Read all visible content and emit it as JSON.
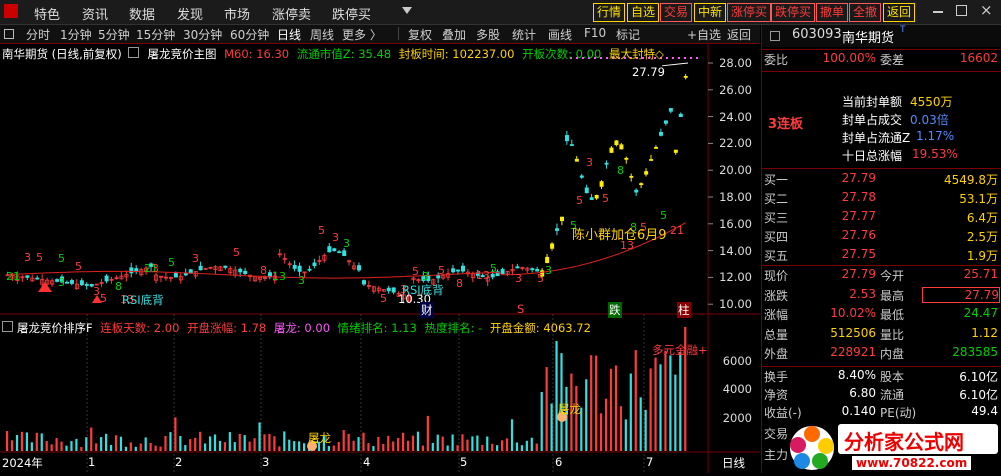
{
  "menu": {
    "items": [
      "特色",
      "资讯",
      "数据",
      "发现",
      "市场",
      "涨停卖",
      "跌停买"
    ],
    "top_buttons": [
      "行情",
      "自选",
      "交易",
      "中新",
      "涨停买",
      "跌停买",
      "撤单",
      "全撤",
      "返回"
    ]
  },
  "periods": {
    "items": [
      "分时",
      "1分钟",
      "5分钟",
      "15分钟",
      "30分钟",
      "60分钟",
      "日线",
      "周线",
      "更多 〉"
    ],
    "tools": [
      "复权",
      "叠加",
      "多股",
      "统计",
      "画线",
      "F10",
      "标记",
      "+自选",
      "返回"
    ]
  },
  "main_info": {
    "title": "南华期货 (日线,前复权)",
    "indicator": "屠龙竞价主图",
    "m60": "M60: 16.30",
    "float_mv": "流通市值Z: 35.48",
    "seal_time": "封板时间: 102237.00",
    "open_count": "开板次数: 0.00",
    "max_seal": "最大封特◇"
  },
  "price_axis": [
    "28.00",
    "26.00",
    "24.00",
    "22.00",
    "20.00",
    "18.00",
    "16.00",
    "14.00",
    "12.00",
    "10.00"
  ],
  "annotations": {
    "top_price": "27.79",
    "low_price": "10.30",
    "news": "陈小群加仓6月9",
    "rsi1": "RSI底背",
    "rsi2": "RSI底背",
    "zhu": "柱",
    "cai": "财",
    "s_mark": "S",
    "jiao": "跌",
    "duo": "多元金融+"
  },
  "seq_labels": [
    "21",
    "3",
    "5",
    "3",
    "5",
    "5",
    "3",
    "5",
    "8",
    "13",
    "21",
    "3",
    "5",
    "3",
    "5",
    "8",
    "13",
    "3",
    "5",
    "3",
    "3",
    "5",
    "3",
    "5",
    "3",
    "5",
    "8",
    "13",
    "5",
    "3",
    "5",
    "3",
    "5",
    "5",
    "3",
    "5",
    "8",
    "13",
    "8",
    "5",
    "5",
    "21",
    "3",
    "5",
    "3",
    "5",
    "3"
  ],
  "sub_info": {
    "indicator": "屠龙竞价排序F",
    "limit_days": "连板天数: 2.00",
    "open_rise": "开盘涨幅: 1.78",
    "tulong": "屠龙: 0.00",
    "mood_rank": "情绪排名: 1.13",
    "heat_rank": "热度排名: -",
    "open_amount": "开盘金额: 4063.72"
  },
  "sub_axis": [
    "6000",
    "4000",
    "2000"
  ],
  "sub_marks": [
    "屠龙",
    "屠龙"
  ],
  "timeline": [
    "2024年",
    "1",
    "2",
    "3",
    "4",
    "5",
    "6",
    "7"
  ],
  "timeline_right": "日线",
  "quote": {
    "code": "603093",
    "name": "南华期货",
    "wb_label": "委比",
    "wb": "100.00%",
    "wc_label": "委差",
    "wc": "16602",
    "seal_amount_label": "当前封单额",
    "seal_amount": "4550万",
    "seal_ratio_label": "封单占成交",
    "seal_ratio": "0.03倍",
    "seal_float_label": "封单占流通Z",
    "seal_float": "1.17%",
    "ten_day_label": "十日总涨幅",
    "ten_day": "19.53%",
    "streak": "3连板",
    "bids": [
      {
        "label": "买一",
        "price": "27.79",
        "vol": "4549.8万"
      },
      {
        "label": "买二",
        "price": "27.78",
        "vol": "53.1万"
      },
      {
        "label": "买三",
        "price": "27.77",
        "vol": "6.4万"
      },
      {
        "label": "买四",
        "price": "27.76",
        "vol": "2.5万"
      },
      {
        "label": "买五",
        "price": "27.75",
        "vol": "1.9万"
      }
    ],
    "stats": [
      {
        "l1": "现价",
        "v1": "27.79",
        "l2": "今开",
        "v2": "25.71"
      },
      {
        "l1": "涨跌",
        "v1": "2.53",
        "l2": "最高",
        "v2": "27.79"
      },
      {
        "l1": "涨幅",
        "v1": "10.02%",
        "l2": "最低",
        "v2": "24.47"
      },
      {
        "l1": "总量",
        "v1": "512506",
        "l2": "量比",
        "v2": "1.12"
      },
      {
        "l1": "外盘",
        "v1": "228921",
        "l2": "内盘",
        "v2": "283585"
      }
    ],
    "stats2": [
      {
        "l1": "换手",
        "v1": "8.40%",
        "l2": "股本",
        "v2": "6.10亿"
      },
      {
        "l1": "净资",
        "v1": "6.80",
        "l2": "流通",
        "v2": "6.10亿"
      },
      {
        "l1": "收益(-)",
        "v1": "0.140",
        "l2": "PE(动)",
        "v2": "49.4"
      }
    ],
    "trade_label": "交易",
    "main_label": "主力"
  },
  "logo": {
    "name": "分析家公式网",
    "url": "www.70822.com"
  }
}
